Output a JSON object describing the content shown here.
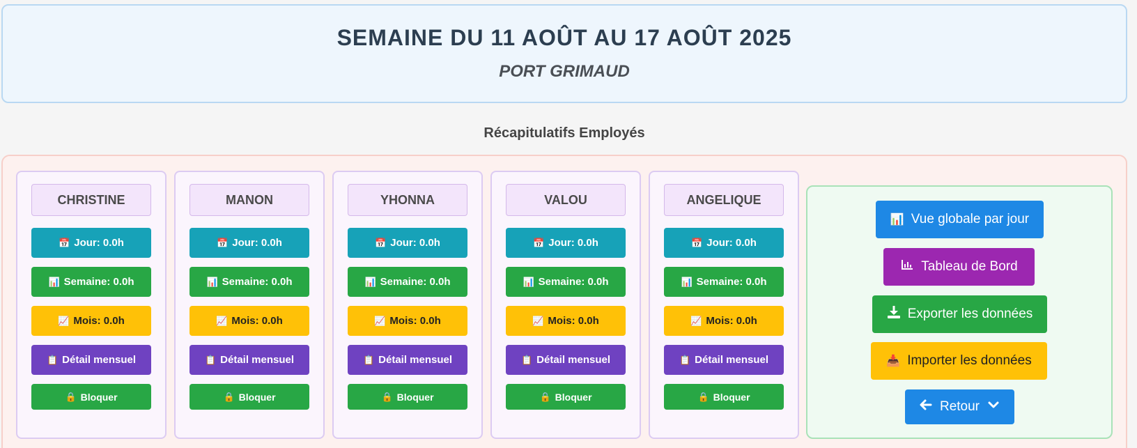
{
  "header": {
    "title": "SEMAINE DU 11 AOÛT AU 17 AOÛT 2025",
    "subtitle": "PORT GRIMAUD"
  },
  "section_title": "Récapitulatifs Employés",
  "employees": [
    {
      "name": "CHRISTINE",
      "jour": "Jour: 0.0h",
      "semaine": "Semaine: 0.0h",
      "mois": "Mois: 0.0h",
      "detail": "Détail mensuel",
      "bloquer": "Bloquer"
    },
    {
      "name": "MANON",
      "jour": "Jour: 0.0h",
      "semaine": "Semaine: 0.0h",
      "mois": "Mois: 0.0h",
      "detail": "Détail mensuel",
      "bloquer": "Bloquer"
    },
    {
      "name": "YHONNA",
      "jour": "Jour: 0.0h",
      "semaine": "Semaine: 0.0h",
      "mois": "Mois: 0.0h",
      "detail": "Détail mensuel",
      "bloquer": "Bloquer"
    },
    {
      "name": "VALOU",
      "jour": "Jour: 0.0h",
      "semaine": "Semaine: 0.0h",
      "mois": "Mois: 0.0h",
      "detail": "Détail mensuel",
      "bloquer": "Bloquer"
    },
    {
      "name": "ANGELIQUE",
      "jour": "Jour: 0.0h",
      "semaine": "Semaine: 0.0h",
      "mois": "Mois: 0.0h",
      "detail": "Détail mensuel",
      "bloquer": "Bloquer"
    }
  ],
  "icons": {
    "jour": "📅",
    "semaine": "📊",
    "mois": "📈",
    "detail": "📋",
    "bloquer": "🔒",
    "vue_globale": "📊",
    "importer": "📥"
  },
  "actions": {
    "vue_globale": "Vue globale par jour",
    "tableau_bord": "Tableau de Bord",
    "exporter": "Exporter les données",
    "importer": "Importer les données",
    "retour": "Retour"
  },
  "colors": {
    "jour": "#17a2b8",
    "semaine": "#28a745",
    "mois": "#ffc107",
    "detail": "#6f42c1",
    "bloquer": "#28a745",
    "primary": "#1e88e5",
    "purple": "#9c27b0"
  }
}
